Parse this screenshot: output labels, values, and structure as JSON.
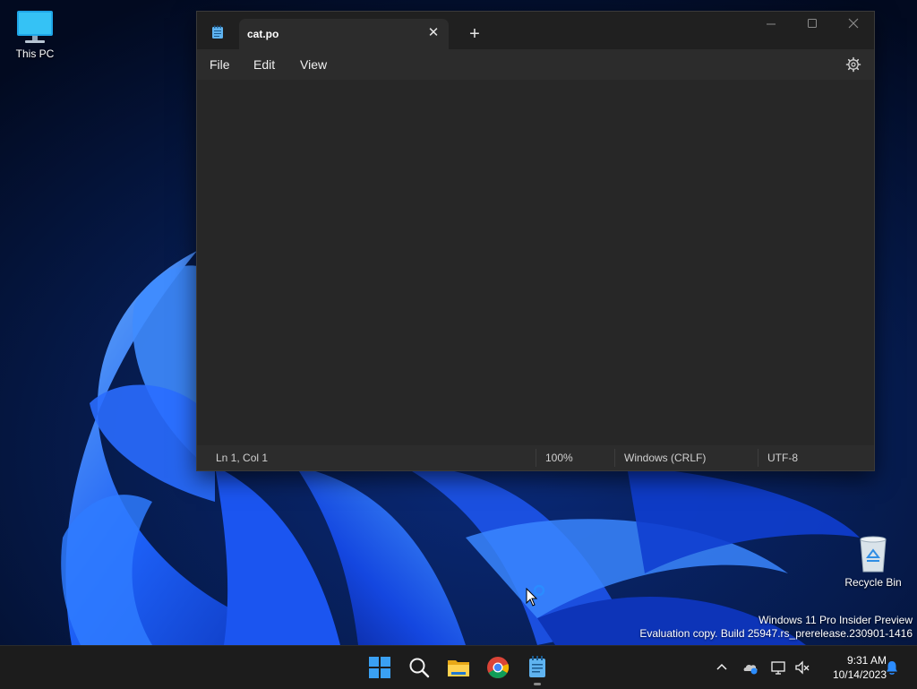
{
  "desktop": {
    "this_pc_label": "This PC",
    "recycle_bin_label": "Recycle Bin",
    "watermark_line1": "Windows 11 Pro Insider Preview",
    "watermark_line2": "Evaluation copy. Build 25947.rs_prerelease.230901-1416"
  },
  "notepad": {
    "tab_title": "cat.po",
    "menu": [
      "File",
      "Edit",
      "View"
    ],
    "content": "",
    "status": {
      "position": "Ln 1, Col 1",
      "zoom": "100%",
      "line_ending": "Windows (CRLF)",
      "encoding": "UTF-8"
    }
  },
  "taskbar": {
    "time": "9:31 AM",
    "date": "10/14/2023",
    "pinned": [
      "start-icon",
      "search-icon",
      "file-explorer-icon",
      "chrome-icon",
      "notepad-icon"
    ]
  },
  "colors": {
    "accent": "#0078d4",
    "window_bg": "#272727",
    "titlebar_bg": "#202020",
    "taskbar_bg": "#1c1c1c"
  }
}
